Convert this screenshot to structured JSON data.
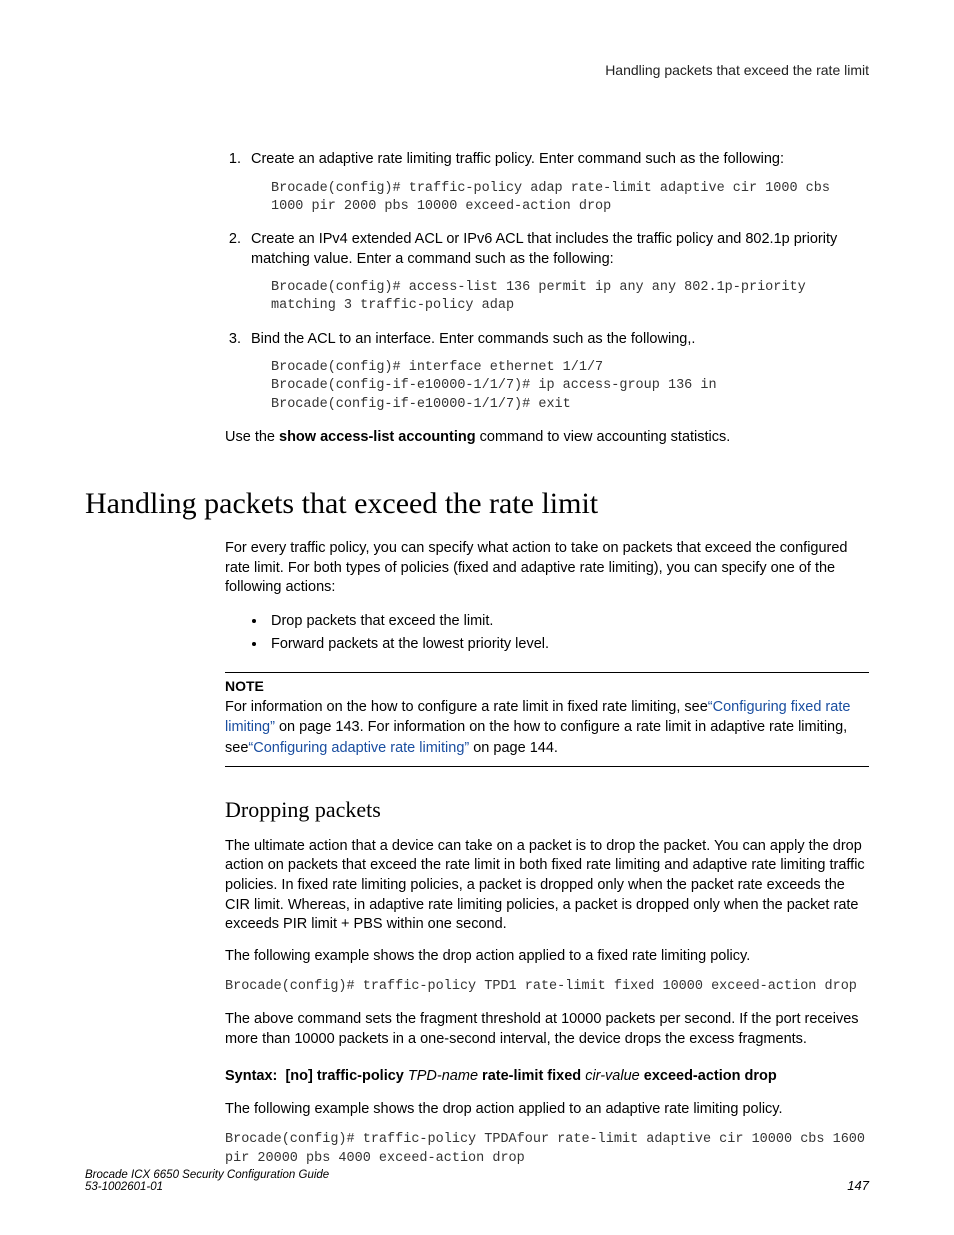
{
  "running_head": "Handling packets that exceed the rate limit",
  "steps": [
    {
      "text": "Create an adaptive rate limiting traffic policy. Enter command such as the following:",
      "code": "Brocade(config)# traffic-policy adap rate-limit adaptive cir 1000 cbs 1000 pir 2000 pbs 10000 exceed-action drop"
    },
    {
      "text": "Create an IPv4 extended ACL or IPv6 ACL that includes the traffic policy and 802.1p priority matching value. Enter a command such as the following:",
      "code": "Brocade(config)# access-list 136 permit ip any any 802.1p-priority matching 3 traffic-policy adap"
    },
    {
      "text": "Bind the ACL to an interface. Enter commands such as the following,.",
      "code": "Brocade(config)# interface ethernet 1/1/7\nBrocade(config-if-e10000-1/1/7)# ip access-group 136 in\nBrocade(config-if-e10000-1/1/7)# exit"
    }
  ],
  "use_line_pre": "Use the ",
  "use_line_cmd": "show access-list accounting",
  "use_line_post": " command to view accounting statistics.",
  "h1": "Handling packets that exceed the rate limit",
  "intro_para": "For every traffic policy, you can specify what action to take on packets that exceed the configured rate limit. For both types of policies (fixed and adaptive rate limiting), you can specify one of the following actions:",
  "bullets": [
    "Drop packets that exceed the limit.",
    "Forward packets at the lowest priority level."
  ],
  "note": {
    "label": "NOTE",
    "pre1": "For information on the how to configure a rate limit in fixed rate limiting, see",
    "link1": "“Configuring fixed rate limiting”",
    "mid1": " on page 143. For information on the how to configure a rate limit in adaptive rate limiting, see",
    "link2": "“Configuring adaptive rate limiting”",
    "post": " on page 144."
  },
  "h2": "Dropping packets",
  "drop_para1": "The ultimate action that a device can take on a packet is to drop the packet. You can apply the drop action on packets that exceed the rate limit in both fixed rate limiting and adaptive rate limiting traffic policies. In fixed rate limiting policies, a packet is dropped only when the packet rate exceeds the CIR limit. Whereas, in adaptive rate limiting policies, a packet is dropped only when the packet rate exceeds PIR limit + PBS within one second.",
  "drop_para2": "The following example shows the drop action applied to a fixed rate limiting policy.",
  "drop_code1": "Brocade(config)# traffic-policy TPD1 rate-limit fixed 10000 exceed-action drop",
  "drop_para3": "The above command sets the fragment threshold at 10000 packets per second. If the port receives more than 10000 packets in a one-second interval, the device drops the excess fragments.",
  "syntax": {
    "label": "Syntax:",
    "p1": "[no] traffic-policy",
    "p2": "TPD-name",
    "p3": "rate-limit fixed",
    "p4": "cir-value",
    "p5": "exceed-action drop"
  },
  "drop_para4": "The following example shows the drop action applied to an adaptive rate limiting policy.",
  "drop_code2": "Brocade(config)# traffic-policy TPDAfour rate-limit adaptive cir 10000 cbs 1600 pir 20000 pbs 4000 exceed-action drop",
  "footer": {
    "title": "Brocade ICX 6650 Security Configuration Guide",
    "docnum": "53-1002601-01",
    "page": "147"
  }
}
